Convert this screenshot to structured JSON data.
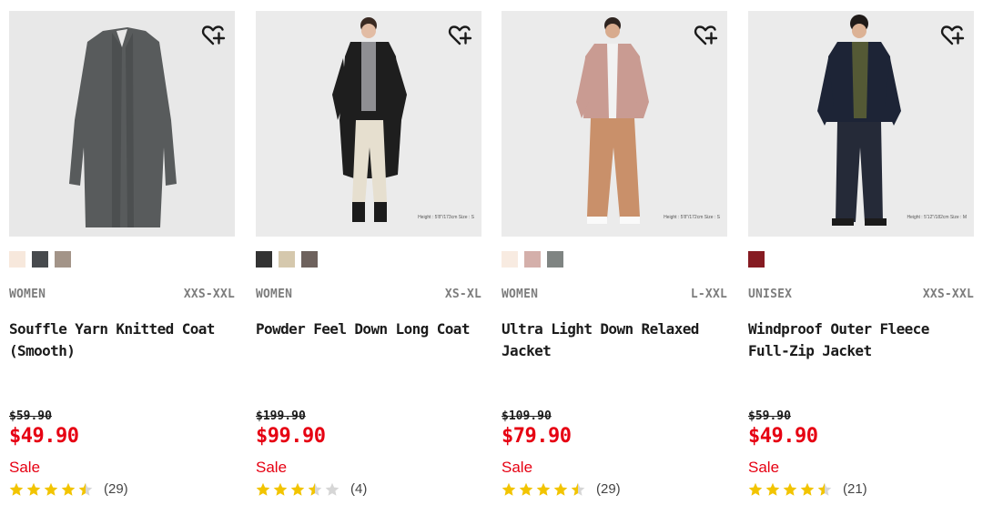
{
  "products": [
    {
      "gender": "WOMEN",
      "sizes": "XXS-XXL",
      "name": "Souffle Yarn Knitted Coat (Smooth)",
      "original_price": "$59.90",
      "sale_price": "$49.90",
      "sale_label": "Sale",
      "rating": 4.5,
      "reviews": "(29)",
      "swatches": [
        "#f7e8dc",
        "#474a4d",
        "#a39488"
      ],
      "image_icon": "knitted-coat-image",
      "model_note": ""
    },
    {
      "gender": "WOMEN",
      "sizes": "XS-XL",
      "name": "Powder Feel Down Long Coat",
      "original_price": "$199.90",
      "sale_price": "$99.90",
      "sale_label": "Sale",
      "rating": 3.5,
      "reviews": "(4)",
      "swatches": [
        "#333333",
        "#d5c8ad",
        "#6e625d"
      ],
      "image_icon": "down-long-coat-image",
      "model_note": "Height : 5'8\"/173cm  Size : S"
    },
    {
      "gender": "WOMEN",
      "sizes": "L-XXL",
      "name": "Ultra Light Down Relaxed Jacket",
      "original_price": "$109.90",
      "sale_price": "$79.90",
      "sale_label": "Sale",
      "rating": 4.5,
      "reviews": "(29)",
      "swatches": [
        "#f8ebe1",
        "#d4afaa",
        "#7f8482"
      ],
      "image_icon": "down-jacket-image",
      "model_note": "Height : 5'8\"/172cm  Size : S"
    },
    {
      "gender": "UNISEX",
      "sizes": "XXS-XXL",
      "name": "Windproof Outer Fleece Full-Zip Jacket",
      "original_price": "$59.90",
      "sale_price": "$49.90",
      "sale_label": "Sale",
      "rating": 4.5,
      "reviews": "(21)",
      "swatches": [
        "#861b22"
      ],
      "image_icon": "fleece-jacket-image",
      "model_note": "Height : 5'12\"/182cm  Size : M"
    }
  ],
  "colors": {
    "sale_red": "#e60012",
    "star_gold": "#f2c400",
    "star_empty": "#d6d6d6",
    "meta_gray": "#7d7d7d"
  },
  "icons": {
    "wishlist": "heart-plus-icon",
    "star": "star-icon"
  }
}
